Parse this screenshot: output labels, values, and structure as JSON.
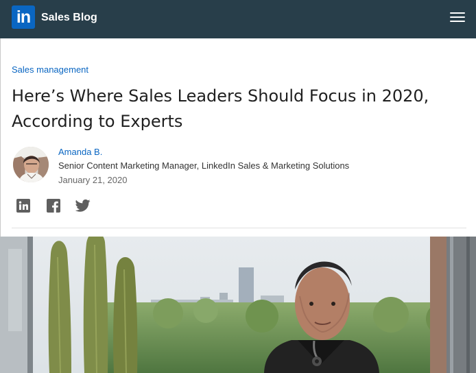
{
  "header": {
    "logo_text": "in",
    "site_title": "Sales Blog",
    "menu_icon": "hamburger-menu-icon",
    "background_color": "#283e4a",
    "logo_color": "#0a66c2"
  },
  "article": {
    "category": "Sales management",
    "title": "Here’s Where Sales Leaders Should Focus in 2020, According to Experts",
    "author": {
      "name": "Amanda B.",
      "role": "Senior Content Marketing Manager, LinkedIn Sales & Marketing Solutions",
      "date": "January 21, 2020",
      "avatar_icon": "author-avatar"
    },
    "share_icons": [
      "linkedin-icon",
      "facebook-icon",
      "twitter-icon"
    ],
    "hero_image": "office-window-portrait-photo"
  },
  "colors": {
    "link": "#0a66c2",
    "headline": "#1f1f1f",
    "body_text": "#333333",
    "muted_text": "#666666"
  }
}
